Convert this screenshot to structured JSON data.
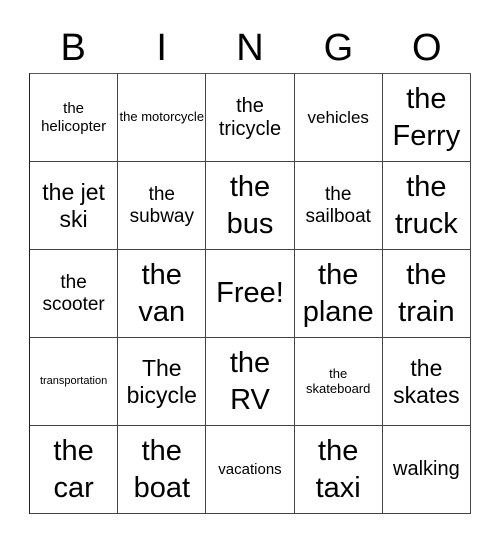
{
  "header": {
    "letters": [
      "B",
      "I",
      "N",
      "G",
      "O"
    ]
  },
  "grid": {
    "rows": [
      [
        {
          "text": "the helicopter",
          "size": "s-sm"
        },
        {
          "text": "the motorcycle",
          "size": "s-xs2"
        },
        {
          "text": "the tricycle",
          "size": "s-ml"
        },
        {
          "text": "vehicles",
          "size": "s-md"
        },
        {
          "text": "the Ferry",
          "size": "s-xl"
        }
      ],
      [
        {
          "text": "the jet ski",
          "size": "s-lg"
        },
        {
          "text": "the subway",
          "size": "s-ml2"
        },
        {
          "text": "the bus",
          "size": "s-xl"
        },
        {
          "text": "the sailboat",
          "size": "s-ml2"
        },
        {
          "text": "the truck",
          "size": "s-xl"
        }
      ],
      [
        {
          "text": "the scooter",
          "size": "s-ml2"
        },
        {
          "text": "the van",
          "size": "s-xl"
        },
        {
          "text": "Free!",
          "size": "s-free"
        },
        {
          "text": "the plane",
          "size": "s-xl"
        },
        {
          "text": "the train",
          "size": "s-xl"
        }
      ],
      [
        {
          "text": "transportation",
          "size": "s-xs"
        },
        {
          "text": "The bicycle",
          "size": "s-lg"
        },
        {
          "text": "the RV",
          "size": "s-xl"
        },
        {
          "text": "the skateboard",
          "size": "s-xs2"
        },
        {
          "text": "the skates",
          "size": "s-lg"
        }
      ],
      [
        {
          "text": "the car",
          "size": "s-xl"
        },
        {
          "text": "the boat",
          "size": "s-xl"
        },
        {
          "text": "vacations",
          "size": "s-sm"
        },
        {
          "text": "the taxi",
          "size": "s-xl"
        },
        {
          "text": "walking",
          "size": "s-ml"
        }
      ]
    ]
  }
}
